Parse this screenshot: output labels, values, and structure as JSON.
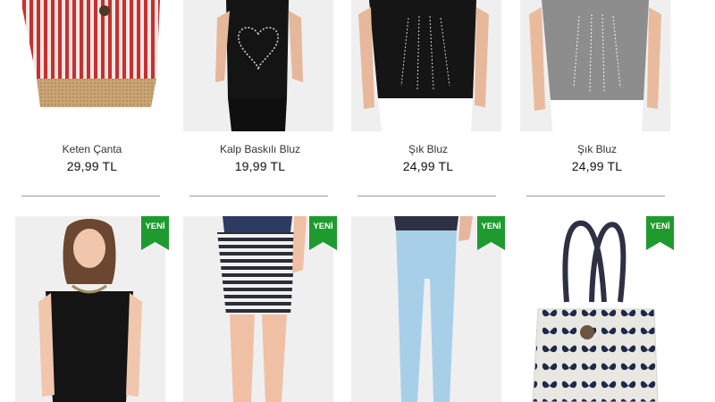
{
  "products_row1": [
    {
      "name": "Keten Çanta",
      "price": "29,99 TL"
    },
    {
      "name": "Kalp Baskılı Bluz",
      "price": "19,99 TL"
    },
    {
      "name": "Şık Bluz",
      "price": "24,99 TL"
    },
    {
      "name": "Şık Bluz",
      "price": "24,99 TL"
    }
  ],
  "products_row2": [
    {
      "badge": "YENİ"
    },
    {
      "badge": "YENİ"
    },
    {
      "badge": "YENİ"
    },
    {
      "badge": "YENİ"
    }
  ],
  "colors": {
    "badge_green": "#1f9a2f",
    "divider": "#9a9a9a"
  }
}
